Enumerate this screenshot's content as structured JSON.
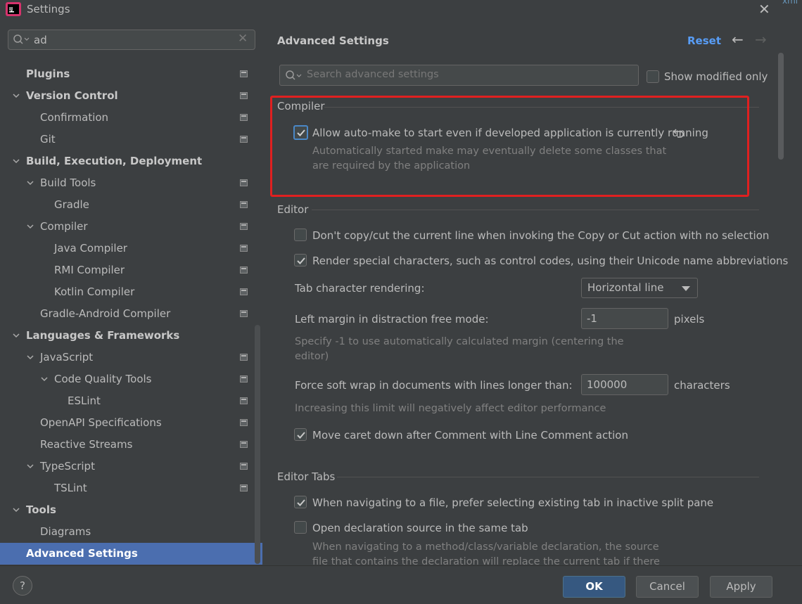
{
  "window": {
    "title": "Settings",
    "edge_text": "xml"
  },
  "search": {
    "value": "ad"
  },
  "sidebar": {
    "items": [
      {
        "label": "Plugins",
        "level": 0,
        "bold": true,
        "expandable": false,
        "page_icon": true
      },
      {
        "label": "Version Control",
        "level": 0,
        "bold": true,
        "expandable": true,
        "page_icon": true
      },
      {
        "label": "Confirmation",
        "level": 1,
        "bold": false,
        "expandable": false,
        "page_icon": true
      },
      {
        "label": "Git",
        "level": 1,
        "bold": false,
        "expandable": false,
        "page_icon": true
      },
      {
        "label": "Build, Execution, Deployment",
        "level": 0,
        "bold": true,
        "expandable": true,
        "page_icon": false
      },
      {
        "label": "Build Tools",
        "level": 1,
        "bold": false,
        "expandable": true,
        "page_icon": true
      },
      {
        "label": "Gradle",
        "level": 2,
        "bold": false,
        "expandable": false,
        "page_icon": true
      },
      {
        "label": "Compiler",
        "level": 1,
        "bold": false,
        "expandable": true,
        "page_icon": true
      },
      {
        "label": "Java Compiler",
        "level": 2,
        "bold": false,
        "expandable": false,
        "page_icon": true
      },
      {
        "label": "RMI Compiler",
        "level": 2,
        "bold": false,
        "expandable": false,
        "page_icon": true
      },
      {
        "label": "Kotlin Compiler",
        "level": 2,
        "bold": false,
        "expandable": false,
        "page_icon": true
      },
      {
        "label": "Gradle-Android Compiler",
        "level": 1,
        "bold": false,
        "expandable": false,
        "page_icon": true
      },
      {
        "label": "Languages & Frameworks",
        "level": 0,
        "bold": true,
        "expandable": true,
        "page_icon": false
      },
      {
        "label": "JavaScript",
        "level": 1,
        "bold": false,
        "expandable": true,
        "page_icon": true
      },
      {
        "label": "Code Quality Tools",
        "level": 2,
        "bold": false,
        "expandable": true,
        "page_icon": true
      },
      {
        "label": "ESLint",
        "level": 3,
        "bold": false,
        "expandable": false,
        "page_icon": true
      },
      {
        "label": "OpenAPI Specifications",
        "level": 1,
        "bold": false,
        "expandable": false,
        "page_icon": true
      },
      {
        "label": "Reactive Streams",
        "level": 1,
        "bold": false,
        "expandable": false,
        "page_icon": true
      },
      {
        "label": "TypeScript",
        "level": 1,
        "bold": false,
        "expandable": true,
        "page_icon": true
      },
      {
        "label": "TSLint",
        "level": 2,
        "bold": false,
        "expandable": false,
        "page_icon": true
      },
      {
        "label": "Tools",
        "level": 0,
        "bold": true,
        "expandable": true,
        "page_icon": false
      },
      {
        "label": "Diagrams",
        "level": 1,
        "bold": false,
        "expandable": false,
        "page_icon": false
      },
      {
        "label": "Advanced Settings",
        "level": 0,
        "bold": true,
        "expandable": false,
        "page_icon": false,
        "selected": true
      }
    ]
  },
  "main": {
    "title": "Advanced Settings",
    "reset_label": "Reset",
    "search_placeholder": "Search advanced settings",
    "show_modified_label": "Show modified only",
    "compiler": {
      "section": "Compiler",
      "auto_make_label": "Allow auto-make to start even if developed application is currently running",
      "auto_make_checked": true,
      "auto_make_desc_1": "Automatically started make may eventually delete some classes that",
      "auto_make_desc_2": "are required by the application"
    },
    "editor": {
      "section": "Editor",
      "copy_cut_label": "Don't copy/cut the current line when invoking the Copy or Cut action with no selection",
      "copy_cut_checked": false,
      "render_special_label": "Render special characters, such as control codes, using their Unicode name abbreviations",
      "render_special_checked": true,
      "tab_rendering_label": "Tab character rendering:",
      "tab_rendering_value": "Horizontal line",
      "left_margin_label": "Left margin in distraction free mode:",
      "left_margin_value": "-1",
      "left_margin_unit": "pixels",
      "left_margin_desc_1": "Specify -1 to use automatically calculated margin (centering the",
      "left_margin_desc_2": "editor)",
      "soft_wrap_label": "Force soft wrap in documents with lines longer than:",
      "soft_wrap_value": "100000",
      "soft_wrap_unit": "characters",
      "soft_wrap_desc": "Increasing this limit will negatively affect editor performance",
      "move_caret_label": "Move caret down after Comment with Line Comment action",
      "move_caret_checked": true
    },
    "editor_tabs": {
      "section": "Editor Tabs",
      "prefer_existing_label": "When navigating to a file, prefer selecting existing tab in inactive split pane",
      "prefer_existing_checked": true,
      "open_same_tab_label": "Open declaration source in the same tab",
      "open_same_tab_checked": false,
      "open_same_tab_desc_1": "When navigating to a method/class/variable declaration, the source",
      "open_same_tab_desc_2": "file that contains the declaration will replace the current tab if there"
    }
  },
  "footer": {
    "help_label": "?",
    "ok_label": "OK",
    "cancel_label": "Cancel",
    "apply_label": "Apply"
  },
  "colors": {
    "background": "#3c3f41",
    "selection": "#4b6eaf",
    "accent_link": "#589df6",
    "primary_button": "#365880",
    "highlight_box": "#e02020"
  }
}
